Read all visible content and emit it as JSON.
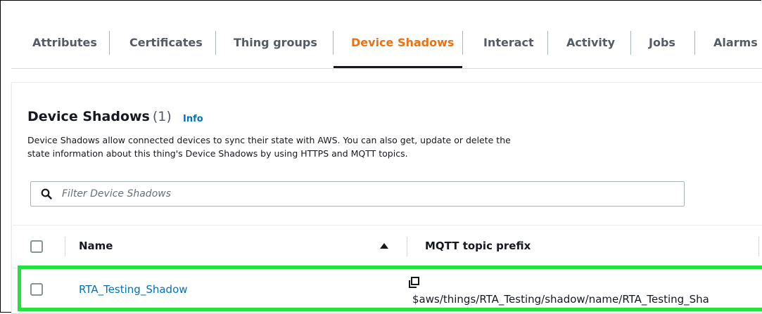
{
  "tabs": [
    {
      "label": "Attributes",
      "active": false
    },
    {
      "label": "Certificates",
      "active": false
    },
    {
      "label": "Thing groups",
      "active": false
    },
    {
      "label": "Device Shadows",
      "active": true
    },
    {
      "label": "Interact",
      "active": false
    },
    {
      "label": "Activity",
      "active": false
    },
    {
      "label": "Jobs",
      "active": false
    },
    {
      "label": "Alarms",
      "active": false
    }
  ],
  "panel": {
    "title": "Device Shadows",
    "count": "(1)",
    "info_link": "Info",
    "description": "Device Shadows allow connected devices to sync their state with AWS. You can also get, update or delete the state information about this thing's Device Shadows by using HTTPS and MQTT topics."
  },
  "filter": {
    "placeholder": "Filter Device Shadows",
    "value": ""
  },
  "table": {
    "columns": [
      "Name",
      "MQTT topic prefix"
    ],
    "sort": "ascending",
    "rows": [
      {
        "name": "RTA_Testing_Shadow",
        "mqtt_topic_prefix": "$aws/things/RTA_Testing/shadow/name/RTA_Testing_Sha",
        "selected": false
      }
    ]
  },
  "colors": {
    "active_tab": "#ec7211",
    "link": "#0073bb",
    "highlight": "#22e33a"
  },
  "icons": [
    "search-icon",
    "sort-ascending-icon",
    "copy-icon"
  ]
}
